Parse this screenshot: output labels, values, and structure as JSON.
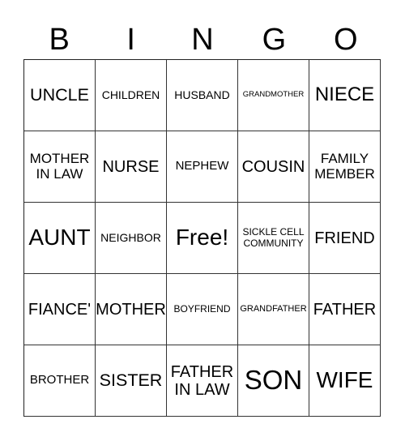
{
  "header": [
    "B",
    "I",
    "N",
    "G",
    "O"
  ],
  "rows": [
    [
      "UNCLE",
      "CHILDREN",
      "HUSBAND",
      "GRANDMOTHER",
      "NIECE"
    ],
    [
      "MOTHER IN LAW",
      "NURSE",
      "NEPHEW",
      "COUSIN",
      "FAMILY MEMBER"
    ],
    [
      "AUNT",
      "NEIGHBOR",
      "Free!",
      "SICKLE CELL COMMUNITY",
      "FRIEND"
    ],
    [
      "FIANCE'",
      "MOTHER",
      "BOYFRIEND",
      "GRANDFATHER",
      "FATHER"
    ],
    [
      "BROTHER",
      "SISTER",
      "FATHER IN LAW",
      "SON",
      "WIFE"
    ]
  ]
}
